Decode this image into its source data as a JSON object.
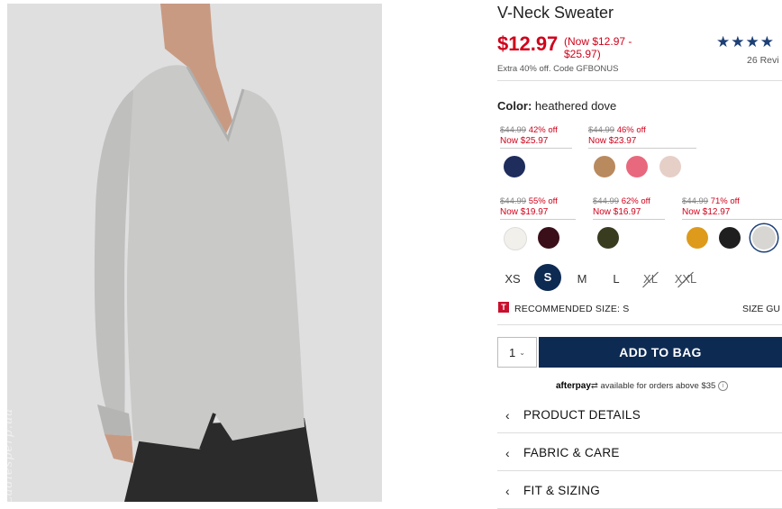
{
  "product": {
    "title": "V-Neck Sweater",
    "price": "$12.97",
    "price_range": "(Now $12.97 - $25.97)",
    "promo": "Extra 40% off. Code GFBONUS",
    "stars": "★★★★",
    "rating_stars": 4,
    "reviews": "26 Revi"
  },
  "photo": {
    "watermark": "Ladiesperp.ua"
  },
  "color": {
    "label": "Color:",
    "value": "heathered dove"
  },
  "price_groups": [
    {
      "strike": "$44.99",
      "off": "42% off",
      "now": "Now $25.97"
    },
    {
      "strike": "$44.99",
      "off": "46% off",
      "now": "Now $23.97"
    },
    {
      "strike": "$44.99",
      "off": "55% off",
      "now": "Now $19.97"
    },
    {
      "strike": "$44.99",
      "off": "62% off",
      "now": "Now $16.97"
    },
    {
      "strike": "$44.99",
      "off": "71% off",
      "now": "Now $12.97"
    }
  ],
  "swatches": [
    {
      "color": "#1e2d5c"
    },
    {
      "color": "#b98a5e"
    },
    {
      "color": "#e8687d"
    },
    {
      "color": "#e6cfc7"
    },
    {
      "color": "#f2f0ea"
    },
    {
      "color": "#3a0f1a"
    },
    {
      "color": "#3a3c20"
    },
    {
      "color": "#dd9a1b"
    },
    {
      "color": "#1f1f1f"
    },
    {
      "color": "#d7d6d3",
      "selected": true
    }
  ],
  "sizes": [
    {
      "label": "XS",
      "state": "available"
    },
    {
      "label": "S",
      "state": "selected"
    },
    {
      "label": "M",
      "state": "available"
    },
    {
      "label": "L",
      "state": "available"
    },
    {
      "label": "XL",
      "state": "unavailable"
    },
    {
      "label": "XXL",
      "state": "unavailable"
    }
  ],
  "recommended": {
    "icon_text": "T",
    "label": "RECOMMENDED SIZE: S",
    "size_guide": "SIZE GU"
  },
  "cart": {
    "qty": "1",
    "add_label": "ADD TO BAG"
  },
  "afterpay": {
    "brand": "afterpay",
    "text": "available for orders above $35",
    "info": "i"
  },
  "sections": [
    {
      "label": "PRODUCT DETAILS"
    },
    {
      "label": "FABRIC & CARE"
    },
    {
      "label": "FIT & SIZING"
    }
  ],
  "colors": {
    "accent_red": "#d0021b",
    "navy": "#0d2a52"
  }
}
